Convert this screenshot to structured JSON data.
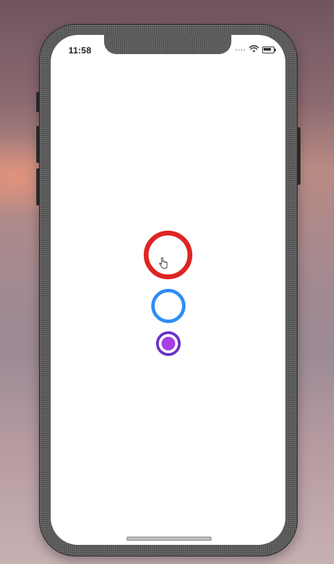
{
  "status_bar": {
    "time": "11:58",
    "signal_icon": "cellular-signal-icon",
    "wifi_icon": "wifi-icon",
    "battery_icon": "battery-icon"
  },
  "content": {
    "buttons": [
      {
        "name": "large-ring-button",
        "color": "#e02424"
      },
      {
        "name": "medium-ring-button",
        "color": "#2f8cf6"
      },
      {
        "name": "small-filled-ring-button",
        "border_color": "#6a2fc9",
        "fill_color": "#a83ee6"
      }
    ],
    "cursor_icon": "hand-pointer-icon"
  },
  "home_indicator": {
    "icon": "home-indicator-bar"
  }
}
